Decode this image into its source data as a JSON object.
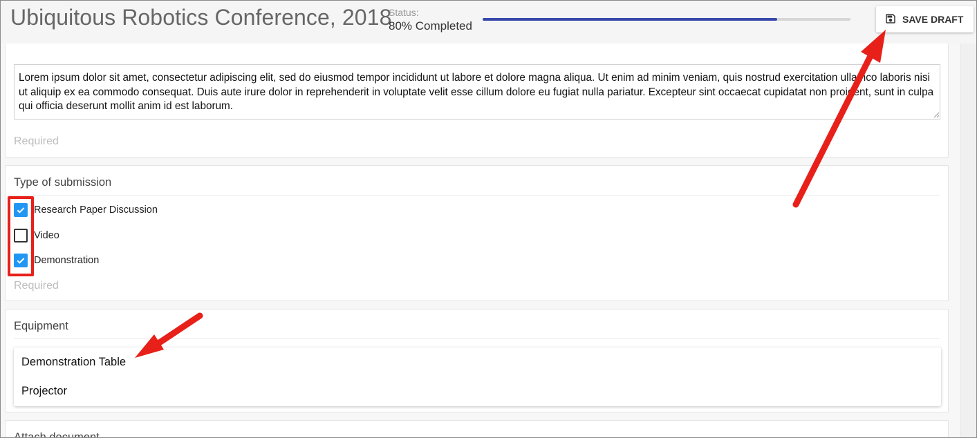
{
  "header": {
    "title": "Ubiquitous Robotics Conference, 2018",
    "status_label": "Status:",
    "status_value": "80% Completed",
    "progress_fraction": 0.8,
    "progress_color": "#3949ab",
    "save_label": "SAVE DRAFT",
    "save_icon": "floppy-disk-icon"
  },
  "description": {
    "text": "Lorem ipsum dolor sit amet, consectetur adipiscing elit, sed do eiusmod tempor incididunt ut labore et dolore magna aliqua. Ut enim ad minim veniam, quis nostrud exercitation ullamco laboris nisi ut aliquip ex ea commodo consequat. Duis aute irure dolor in reprehenderit in voluptate velit esse cillum dolore eu fugiat nulla pariatur. Excepteur sint occaecat cupidatat non proident, sunt in culpa qui officia deserunt mollit anim id est laborum.",
    "hint": "Required"
  },
  "submission": {
    "title": "Type of submission",
    "options": [
      {
        "label": "Research Paper Discussion",
        "checked": true
      },
      {
        "label": "Video",
        "checked": false
      },
      {
        "label": "Demonstration",
        "checked": true
      }
    ],
    "hint": "Required",
    "check_color": "#2196f3"
  },
  "equipment": {
    "title": "Equipment",
    "items": [
      "Demonstration Table",
      "Projector"
    ]
  },
  "attach": {
    "title": "Attach document"
  },
  "annotation_color": "#e8201a"
}
